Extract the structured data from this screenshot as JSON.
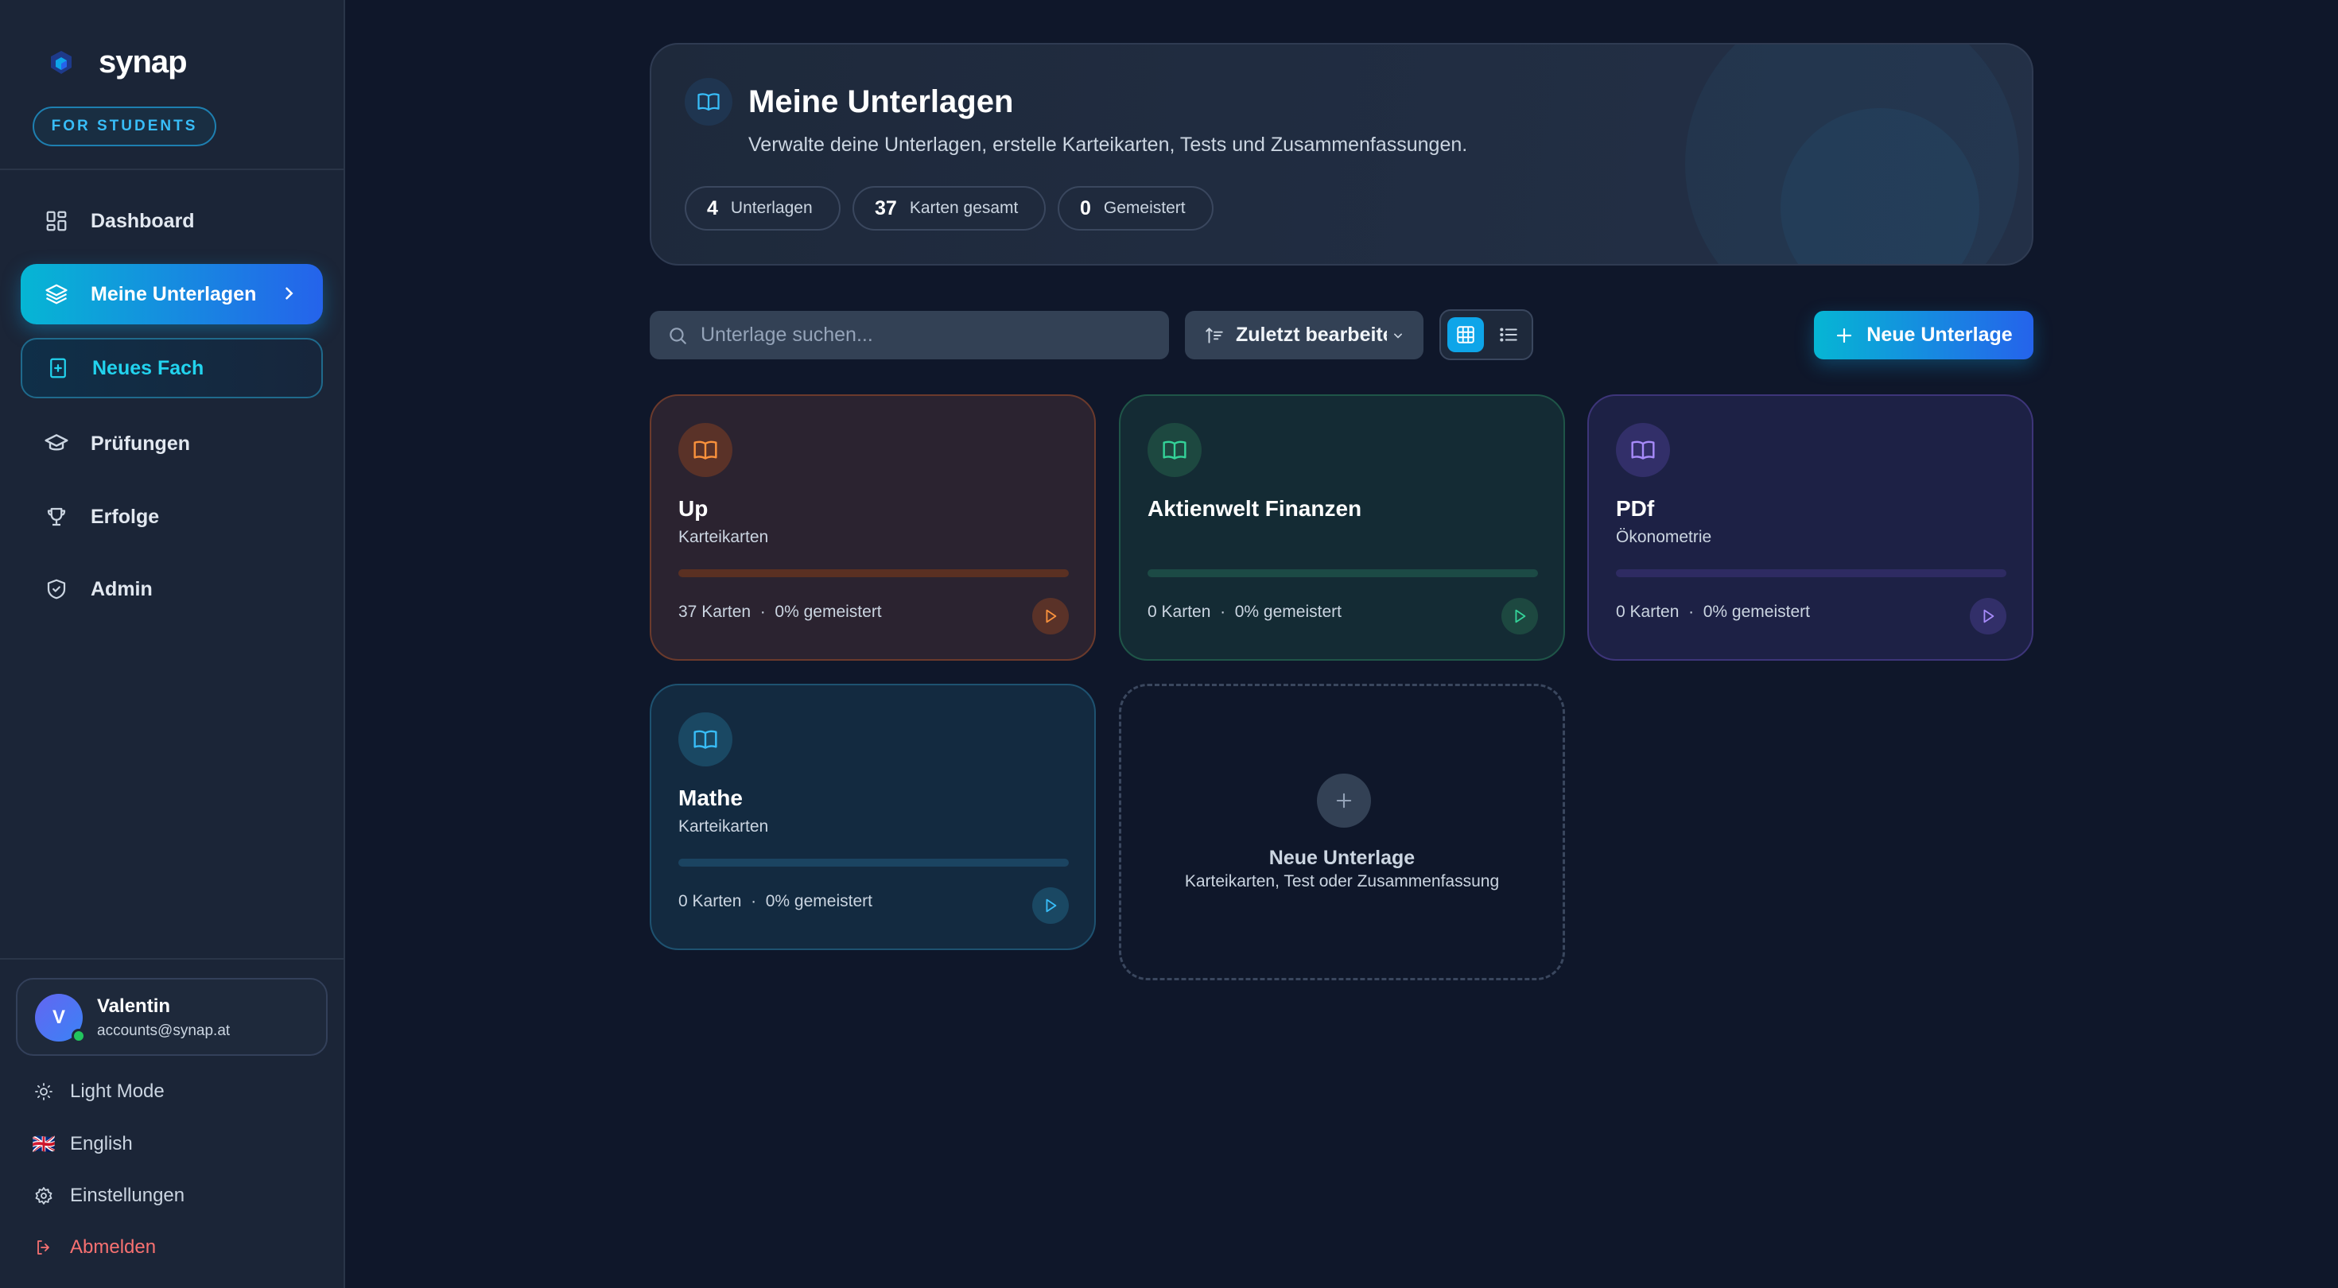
{
  "brand": {
    "name": "synap",
    "badge": "FOR STUDENTS"
  },
  "nav": {
    "items": [
      {
        "label": "Dashboard",
        "icon": "dashboard-icon"
      },
      {
        "label": "Meine Unterlagen",
        "icon": "layers-icon",
        "active": true
      },
      {
        "label": "Neues Fach",
        "icon": "new-book-icon"
      },
      {
        "label": "Prüfungen",
        "icon": "graduation-cap-icon"
      },
      {
        "label": "Erfolge",
        "icon": "trophy-icon"
      },
      {
        "label": "Admin",
        "icon": "shield-icon"
      }
    ]
  },
  "user": {
    "initial": "V",
    "name": "Valentin",
    "email": "accounts@synap.at"
  },
  "bottom": {
    "light_mode": "Light Mode",
    "language": "English",
    "language_flag": "🇬🇧",
    "settings": "Einstellungen",
    "logout": "Abmelden"
  },
  "hero": {
    "title": "Meine Unterlagen",
    "subtitle": "Verwalte deine Unterlagen, erstelle Karteikarten, Tests und Zusammenfassungen.",
    "stats": [
      {
        "value": "4",
        "label": "Unterlagen"
      },
      {
        "value": "37",
        "label": "Karten gesamt"
      },
      {
        "value": "0",
        "label": "Gemeistert"
      }
    ]
  },
  "toolbar": {
    "search_placeholder": "Unterlage suchen...",
    "search_value": "",
    "sort_label": "Zuletzt bearbeitet",
    "view_mode": "grid",
    "new_button": "Neue Unterlage"
  },
  "cards": [
    {
      "title": "Up",
      "subtitle": "Karteikarten",
      "cards_text": "37 Karten",
      "separator": "·",
      "mastered_text": "0% gemeistert",
      "progress": 0,
      "color": "#f97316"
    },
    {
      "title": "Aktienwelt Finanzen",
      "subtitle": "",
      "cards_text": "0 Karten",
      "separator": "·",
      "mastered_text": "0% gemeistert",
      "progress": 0,
      "color": "#10b981"
    },
    {
      "title": "PDf",
      "subtitle": "Ökonometrie",
      "cards_text": "0 Karten",
      "separator": "·",
      "mastered_text": "0% gemeistert",
      "progress": 0,
      "color": "#8b5cf6"
    },
    {
      "title": "Mathe",
      "subtitle": "Karteikarten",
      "cards_text": "0 Karten",
      "separator": "·",
      "mastered_text": "0% gemeistert",
      "progress": 0,
      "color": "#0ea5e9"
    }
  ],
  "add_card": {
    "title": "Neue Unterlage",
    "subtitle": "Karteikarten, Test oder Zusammenfassung"
  },
  "colors": {
    "accent_start": "#06b6d4",
    "accent_end": "#2563eb",
    "background": "#0f172a",
    "sidebar": "#1b2537",
    "danger": "#f87171"
  }
}
